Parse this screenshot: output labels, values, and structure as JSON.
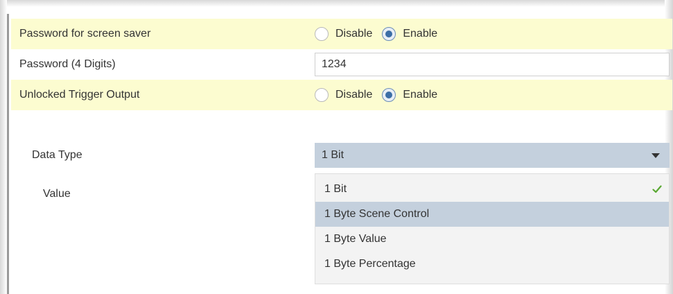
{
  "rows": {
    "screen_saver": {
      "label": "Password for screen saver",
      "options": [
        "Disable",
        "Enable"
      ],
      "selected": "Enable"
    },
    "password": {
      "label": "Password (4 Digits)",
      "value": "1234"
    },
    "unlocked_trigger": {
      "label": "Unlocked Trigger Output",
      "options": [
        "Disable",
        "Enable"
      ],
      "selected": "Enable"
    },
    "data_type": {
      "label": "Data Type",
      "selected": "1 Bit"
    },
    "value": {
      "label": "Value"
    }
  },
  "dropdown": {
    "items": [
      "1 Bit",
      "1 Byte Scene Control",
      "1 Byte Value",
      "1 Byte Percentage"
    ],
    "checked_index": 0,
    "hover_index": 1
  },
  "colors": {
    "highlight_row": "#fcfcd0",
    "select_bg": "#c4d0dd",
    "check_green": "#5aa832",
    "radio_selected": "#3c6ea6"
  },
  "icons": {
    "dropdown_caret": "caret-down-icon",
    "check": "check-icon"
  }
}
